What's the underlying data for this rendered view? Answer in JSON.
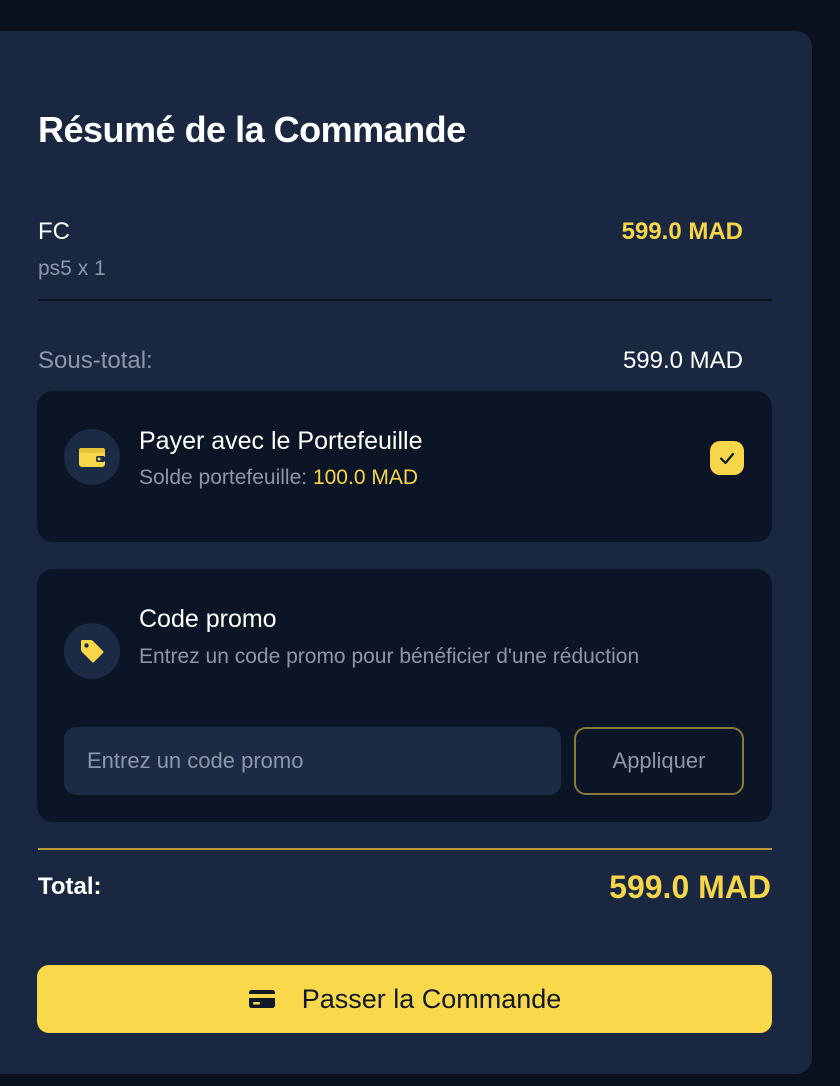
{
  "summary": {
    "title": "Résumé de la Commande",
    "item": {
      "name": "FC",
      "detail": "ps5 x 1",
      "price": "599.0 MAD"
    },
    "subtotal_label": "Sous-total:",
    "subtotal_value": "599.0 MAD"
  },
  "wallet": {
    "title": "Payer avec le Portefeuille",
    "balance_label": "Solde portefeuille: ",
    "balance_value": "100.0 MAD",
    "checked": true,
    "icon": "wallet-icon"
  },
  "promo": {
    "title": "Code promo",
    "description": "Entrez un code promo pour bénéficier d'une réduction",
    "input_value": "",
    "input_placeholder": "Entrez un code promo",
    "apply_label": "Appliquer",
    "icon": "tag-icon"
  },
  "total": {
    "label": "Total:",
    "value": "599.0 MAD"
  },
  "order_button": {
    "label": "Passer la Commande",
    "icon": "credit-card-icon"
  },
  "colors": {
    "background": "#0b111c",
    "panel": "#192741",
    "card": "#0c1526",
    "accent": "#f7d64a",
    "muted_text": "#8d97a8"
  }
}
